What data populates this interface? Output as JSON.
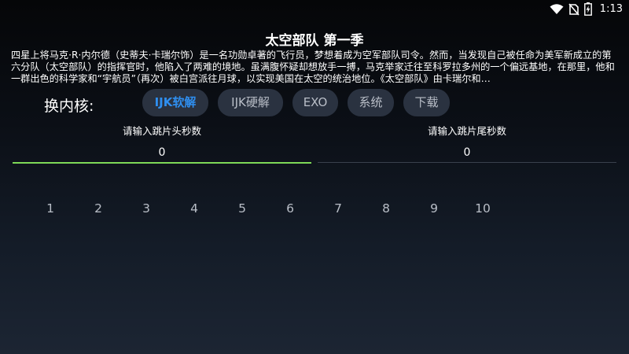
{
  "status_bar": {
    "time": "1:13",
    "icons": [
      "wifi-icon",
      "no-sim-icon",
      "battery-charging-icon"
    ]
  },
  "title": "太空部队 第一季",
  "description": "四星上将马克·R·内尔德（史蒂夫·卡瑞尔饰）是一名功勋卓著的飞行员，梦想着成为空军部队司令。然而，当发现自己被任命为美军新成立的第六分队（太空部队）的指挥官时，他陷入了两难的境地。虽满腹怀疑却想放手一搏，马克举家迁往至科罗拉多州的一个偏远基地，在那里，他和一群出色的科学家和“宇航员”（再次）被白宫派往月球，以实现美国在太空的统治地位。《太空部队》由卡瑞尔和…",
  "kernel": {
    "label": "换内核:",
    "options": [
      "IJK软解",
      "IJK硬解",
      "EXO",
      "系统",
      "下载"
    ],
    "selected": "IJK软解"
  },
  "skip": {
    "head_label": "请输入跳片头秒数",
    "head_value": "0",
    "tail_label": "请输入跳片尾秒数",
    "tail_value": "0"
  },
  "episodes": [
    "1",
    "2",
    "3",
    "4",
    "5",
    "6",
    "7",
    "8",
    "9",
    "10"
  ],
  "colors": {
    "accent_blue": "#2f8ff0",
    "focus_green": "#7ed957",
    "button_bg": "#2a3240",
    "muted_text": "#b9bec7"
  }
}
